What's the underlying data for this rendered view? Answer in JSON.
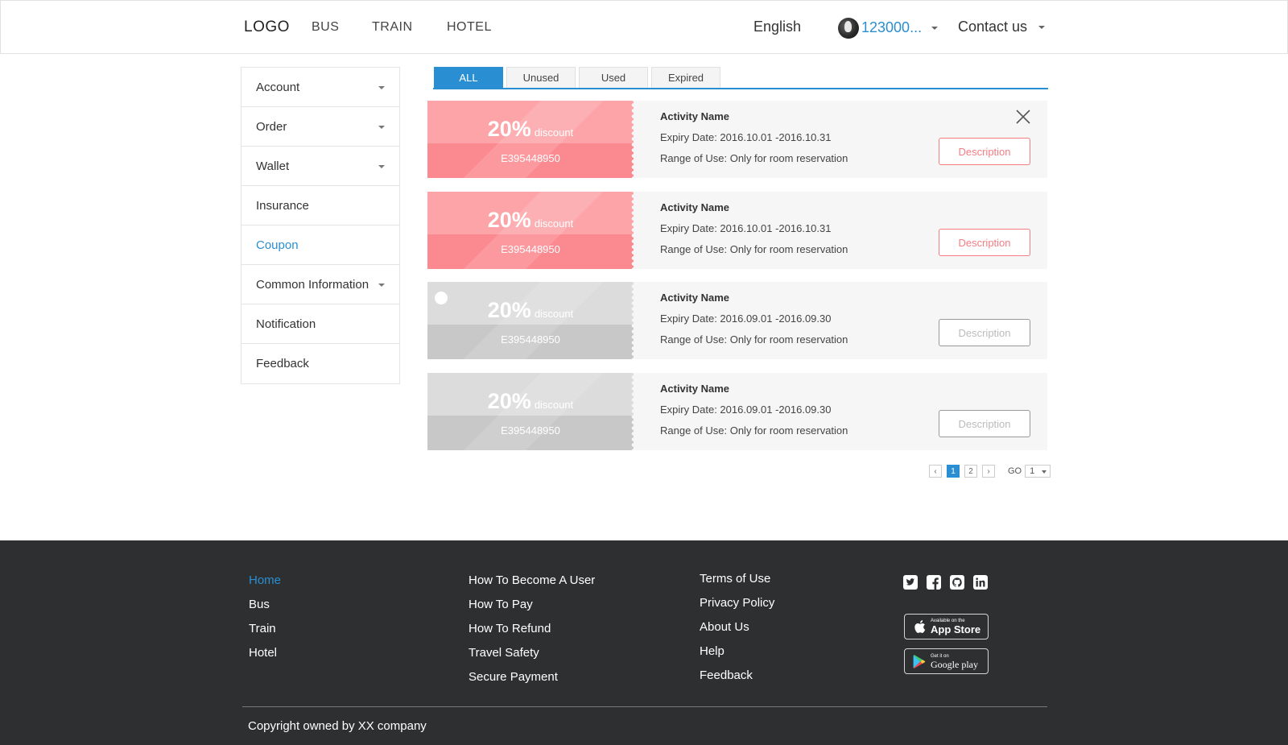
{
  "header": {
    "logo": "LOGO",
    "nav": [
      "BUS",
      "TRAIN",
      "HOTEL"
    ],
    "language": "English",
    "user_name": "123000...",
    "contact": "Contact us"
  },
  "sidebar": {
    "items": [
      {
        "label": "Account",
        "has_caret": true
      },
      {
        "label": "Order",
        "has_caret": true
      },
      {
        "label": "Wallet",
        "has_caret": true
      },
      {
        "label": "Insurance",
        "has_caret": false
      },
      {
        "label": "Coupon",
        "has_caret": false,
        "active": true
      },
      {
        "label": "Common Information",
        "has_caret": true
      },
      {
        "label": "Notification",
        "has_caret": false
      },
      {
        "label": "Feedback",
        "has_caret": false
      }
    ]
  },
  "tabs": {
    "items": [
      "ALL",
      "Unused",
      "Used",
      "Expired"
    ],
    "active": "ALL"
  },
  "coupons": [
    {
      "percent": "20%",
      "discount_word": "discount",
      "code": "E395448950",
      "activity": "Activity Name",
      "expiry": "Expiry Date: 2016.10.01 -2016.10.31",
      "range": "Range of Use: Only for room reservation",
      "button": "Description",
      "state": "red",
      "closable": true
    },
    {
      "percent": "20%",
      "discount_word": "discount",
      "code": "E395448950",
      "activity": "Activity Name",
      "expiry": "Expiry Date: 2016.10.01 -2016.10.31",
      "range": "Range of Use: Only for room reservation",
      "button": "Description",
      "state": "red",
      "closable": false
    },
    {
      "percent": "20%",
      "discount_word": "discount",
      "code": "E395448950",
      "activity": "Activity Name",
      "expiry": "Expiry Date: 2016.09.01 -2016.09.30",
      "range": "Range of Use: Only for room reservation",
      "button": "Description",
      "state": "gray",
      "has_dot": true
    },
    {
      "percent": "20%",
      "discount_word": "discount",
      "code": "E395448950",
      "activity": "Activity Name",
      "expiry": "Expiry Date: 2016.09.01 -2016.09.30",
      "range": "Range of Use: Only for room reservation",
      "button": "Description",
      "state": "gray"
    }
  ],
  "pagination": {
    "prev": "‹",
    "pages": [
      "1",
      "2"
    ],
    "current": "1",
    "next": "›",
    "go_label": "GO",
    "go_value": "1"
  },
  "footer": {
    "col1": [
      "Home",
      "Bus",
      "Train",
      "Hotel"
    ],
    "col2": [
      "How To Become A User",
      "How To Pay",
      "How To Refund",
      "Travel Safety",
      "Secure Payment"
    ],
    "col3": [
      "Terms of Use",
      "Privacy Policy",
      "About Us",
      "Help",
      "Feedback"
    ],
    "social_icons": [
      "twitter-icon",
      "facebook-icon",
      "github-icon",
      "linkedin-icon"
    ],
    "app_store": {
      "small": "Available on the",
      "big": "App Store"
    },
    "google_play": {
      "small": "Get it on",
      "big": "Google play"
    },
    "copyright": "Copyright owned by XX company"
  },
  "colors": {
    "accent": "#2a8fd2",
    "coupon_active": "#fda4a8",
    "coupon_inactive": "#dcdcdc",
    "footer_bg": "#2e2f31"
  }
}
